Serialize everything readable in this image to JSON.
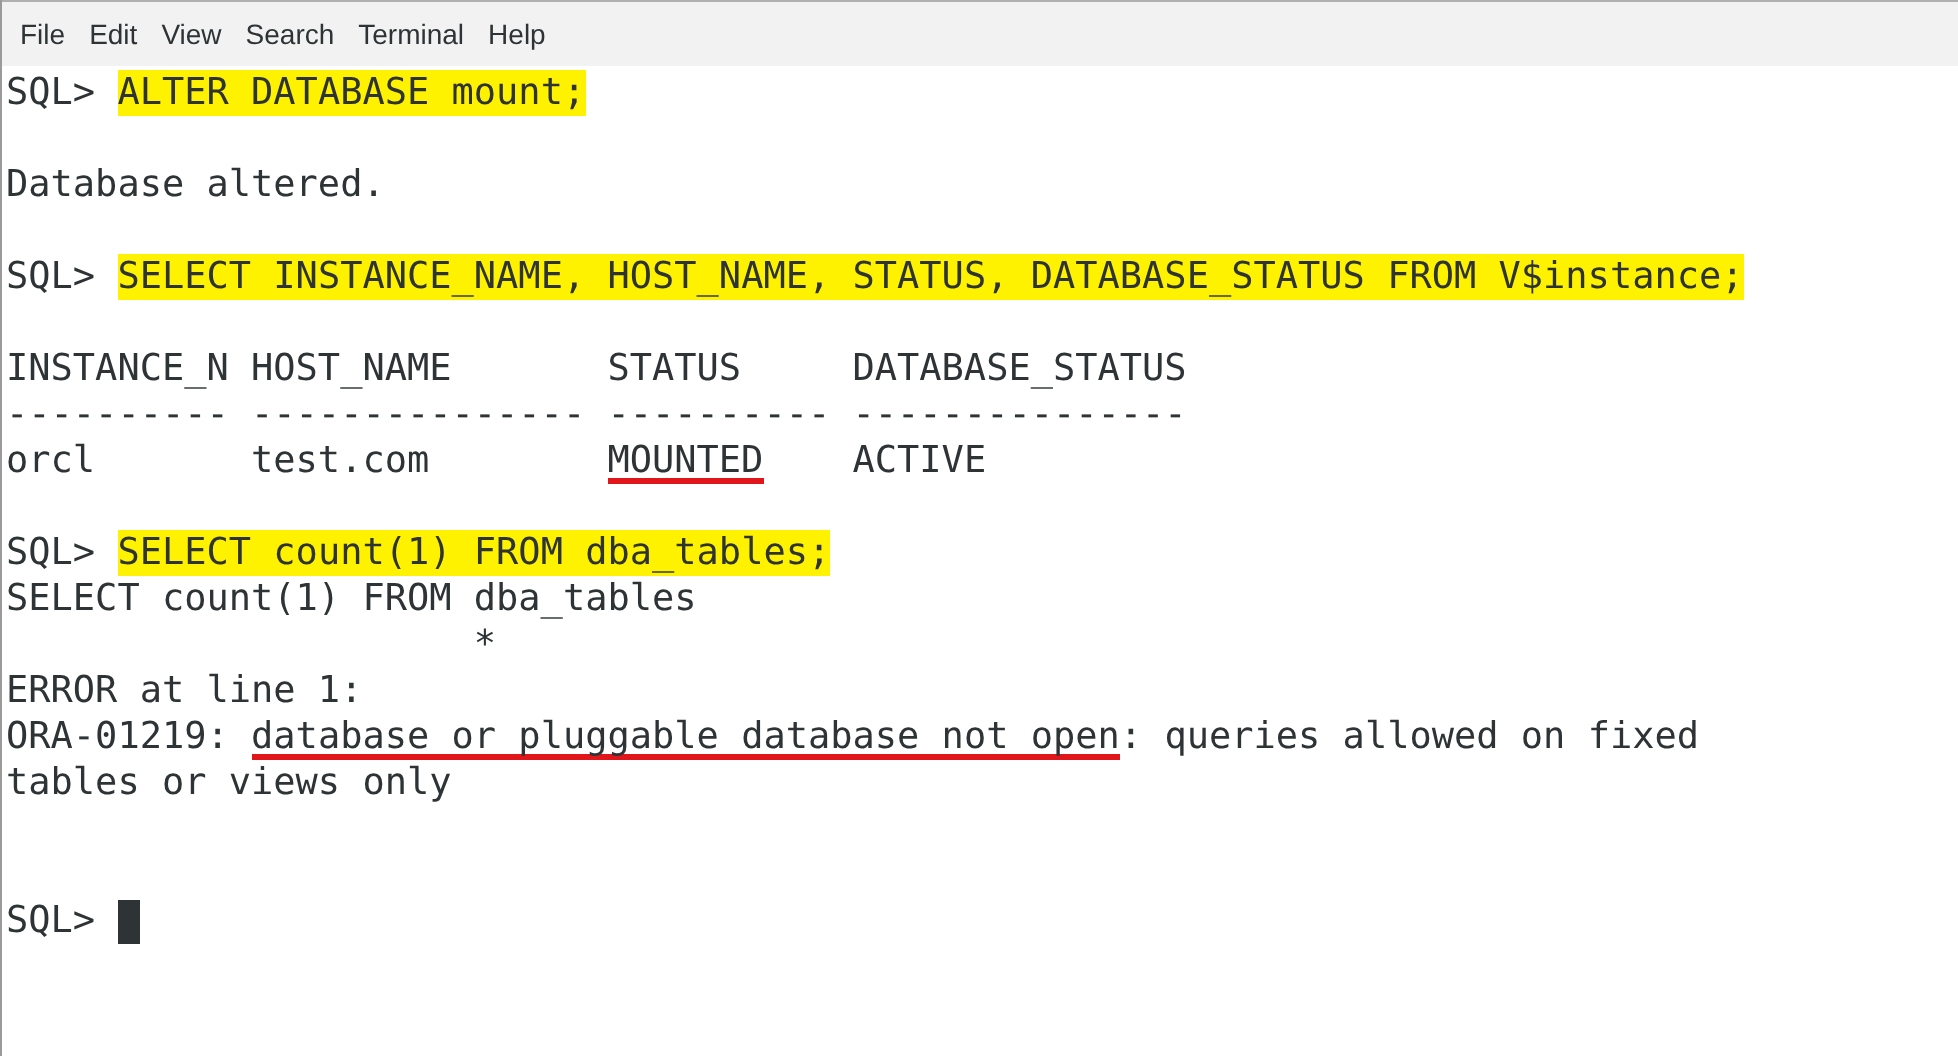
{
  "menu": [
    "File",
    "Edit",
    "View",
    "Search",
    "Terminal",
    "Help"
  ],
  "lines": [
    {
      "kind": "text",
      "segments": [
        {
          "text": "SQL> ",
          "highlighted": false,
          "underlined": false
        },
        {
          "text": "ALTER DATABASE mount;",
          "highlighted": true,
          "underlined": false
        }
      ]
    },
    {
      "kind": "blank"
    },
    {
      "kind": "text",
      "segments": [
        {
          "text": "Database altered.",
          "highlighted": false,
          "underlined": false
        }
      ]
    },
    {
      "kind": "blank"
    },
    {
      "kind": "text",
      "segments": [
        {
          "text": "SQL> ",
          "highlighted": false,
          "underlined": false
        },
        {
          "text": "SELECT INSTANCE_NAME, HOST_NAME, STATUS, DATABASE_STATUS FROM V$instance;",
          "highlighted": true,
          "underlined": false
        }
      ]
    },
    {
      "kind": "blank"
    },
    {
      "kind": "text",
      "segments": [
        {
          "text": "INSTANCE_N HOST_NAME       STATUS     DATABASE_STATUS",
          "highlighted": false,
          "underlined": false
        }
      ]
    },
    {
      "kind": "text",
      "segments": [
        {
          "text": "---------- --------------- ---------- ---------------",
          "highlighted": false,
          "underlined": false
        }
      ]
    },
    {
      "kind": "text",
      "segments": [
        {
          "text": "orcl       test.com        ",
          "highlighted": false,
          "underlined": false
        },
        {
          "text": "MOUNTED",
          "highlighted": false,
          "underlined": true
        },
        {
          "text": "    ACTIVE",
          "highlighted": false,
          "underlined": false
        }
      ]
    },
    {
      "kind": "blank"
    },
    {
      "kind": "text",
      "segments": [
        {
          "text": "SQL> ",
          "highlighted": false,
          "underlined": false
        },
        {
          "text": "SELECT count(1) FROM dba_tables;",
          "highlighted": true,
          "underlined": false
        }
      ]
    },
    {
      "kind": "text",
      "segments": [
        {
          "text": "SELECT count(1) FROM dba_tables",
          "highlighted": false,
          "underlined": false
        }
      ]
    },
    {
      "kind": "text",
      "segments": [
        {
          "text": "                     *",
          "highlighted": false,
          "underlined": false
        }
      ]
    },
    {
      "kind": "text",
      "segments": [
        {
          "text": "ERROR at line 1:",
          "highlighted": false,
          "underlined": false
        }
      ]
    },
    {
      "kind": "text",
      "segments": [
        {
          "text": "ORA-01219: ",
          "highlighted": false,
          "underlined": false
        },
        {
          "text": "database or pluggable database not open",
          "highlighted": false,
          "underlined": true
        },
        {
          "text": ": queries allowed on fixed",
          "highlighted": false,
          "underlined": false
        }
      ]
    },
    {
      "kind": "text",
      "segments": [
        {
          "text": "tables or views only",
          "highlighted": false,
          "underlined": false
        }
      ]
    },
    {
      "kind": "blank"
    },
    {
      "kind": "blank"
    },
    {
      "kind": "prompt",
      "segments": [
        {
          "text": "SQL> ",
          "highlighted": false,
          "underlined": false
        }
      ]
    }
  ]
}
